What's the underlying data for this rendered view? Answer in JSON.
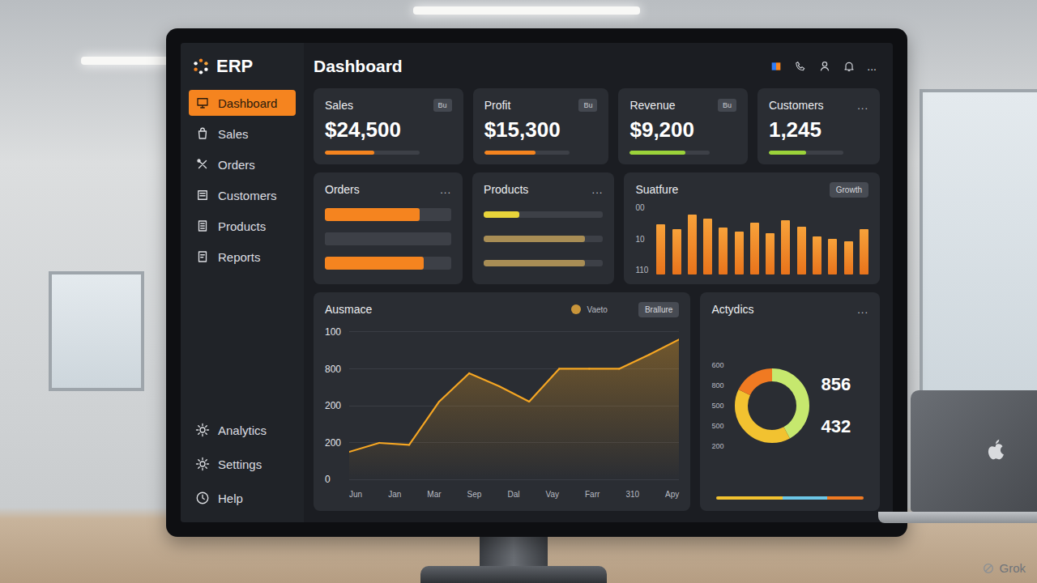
{
  "logo": {
    "text": "ERP"
  },
  "sidebar": {
    "items": [
      {
        "label": "Dashboard",
        "selected": true
      },
      {
        "label": "Sales",
        "selected": false
      },
      {
        "label": "Orders",
        "selected": false
      },
      {
        "label": "Customers",
        "selected": false
      },
      {
        "label": "Products",
        "selected": false
      },
      {
        "label": "Reports",
        "selected": false
      }
    ],
    "footer_items": [
      {
        "label": "Analytics",
        "selected": false
      },
      {
        "label": "Settings",
        "selected": false
      },
      {
        "label": "Help",
        "selected": false
      }
    ]
  },
  "header": {
    "title": "Dashboard",
    "menu": "..."
  },
  "stat_cards": [
    {
      "title": "Sales",
      "value": "$24,500",
      "badge": "Bu",
      "kind": "badge",
      "level": 0.52,
      "color": "#f5841f"
    },
    {
      "title": "Profit",
      "value": "$15,300",
      "badge": "Bu",
      "kind": "badge",
      "level": 0.6,
      "color": "#f5841f"
    },
    {
      "title": "Revenue",
      "value": "$9,200",
      "badge": "Bu",
      "kind": "badge",
      "level": 0.7,
      "color": "#9bd33a"
    },
    {
      "title": "Customers",
      "value": "1,245",
      "badge": "...",
      "kind": "menu",
      "level": 0.5,
      "color": "#9bd33a"
    }
  ],
  "orders": {
    "title": "Orders",
    "menu": "...",
    "bars": [
      {
        "level": 0.75,
        "color": "#f5841f"
      },
      {
        "level": 0.32,
        "color": "#3d4047"
      },
      {
        "level": 0.78,
        "color": "#f5841f"
      }
    ]
  },
  "products": {
    "title": "Products",
    "menu": "...",
    "bars": [
      {
        "level": 0.3,
        "color": "#e8d43a"
      },
      {
        "level": 0.85,
        "color": "#a88d55"
      },
      {
        "level": 0.85,
        "color": "#a88d55"
      }
    ]
  },
  "bar_chart": {
    "title": "Suatfure",
    "button": "Growth",
    "y_ticks": [
      "00",
      "10",
      "110"
    ],
    "max": 100,
    "values": [
      80,
      72,
      95,
      88,
      75,
      68,
      82,
      65,
      86,
      76,
      60,
      56,
      52,
      72
    ]
  },
  "line_chart": {
    "title": "Ausmace",
    "legend": {
      "label": "Vaeto",
      "color": "#c9953a"
    },
    "button": "Brallure",
    "y_ticks": [
      "100",
      "800",
      "200",
      "200",
      "0"
    ],
    "x_labels": [
      "Jun",
      "Jan",
      "Mar",
      "Sep",
      "Dal",
      "Vay",
      "Farr",
      "310",
      "Apy"
    ],
    "max": 400,
    "values": [
      76,
      100,
      95,
      211,
      287,
      252,
      211,
      299,
      299,
      299,
      337,
      378
    ]
  },
  "donut": {
    "title": "Actydics",
    "menu": "...",
    "y_ticks": [
      "600",
      "800",
      "500",
      "500",
      "200"
    ],
    "values": [
      "856",
      "432"
    ],
    "segments": [
      {
        "value": 42,
        "color": "#c6e86e"
      },
      {
        "value": 40,
        "color": "#f2c230"
      },
      {
        "value": 18,
        "color": "#f07a22"
      }
    ],
    "legend_strip": [
      {
        "value": 45,
        "color": "#f2c230"
      },
      {
        "value": 30,
        "color": "#6cc6e6"
      },
      {
        "value": 25,
        "color": "#f07a22"
      }
    ]
  },
  "watermark": {
    "text": "Grok"
  }
}
